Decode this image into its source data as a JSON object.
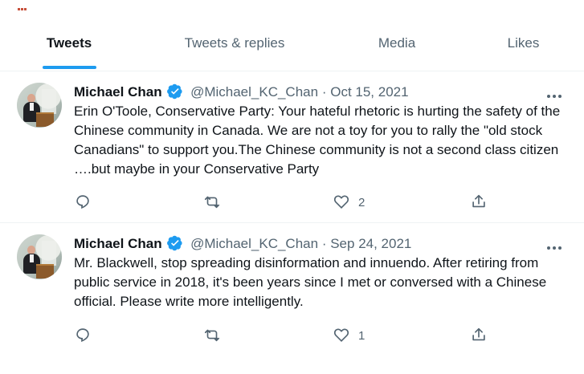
{
  "tabs": [
    {
      "label": "Tweets"
    },
    {
      "label": "Tweets & replies"
    },
    {
      "label": "Media"
    },
    {
      "label": "Likes"
    }
  ],
  "tweets": [
    {
      "author": "Michael Chan",
      "handle": "@Michael_KC_Chan",
      "separator": "·",
      "date": "Oct 15, 2021",
      "text": "Erin O'Toole, Conservative Party: Your hateful rhetoric is hurting the safety of the Chinese community in Canada. We are not a toy for you to rally the \"old stock Canadians\" to support you.The Chinese community is not a second class citizen ….but maybe in your Conservative Party",
      "likes": "2"
    },
    {
      "author": "Michael Chan",
      "handle": "@Michael_KC_Chan",
      "separator": "·",
      "date": "Sep 24, 2021",
      "text": "Mr. Blackwell, stop spreading disinformation and innuendo. After retiring from public service in 2018, it's been years since I met or conversed with a Chinese official.  Please write more intelligently.",
      "likes": "1"
    }
  ],
  "icons": {
    "verified": "verified-badge-icon",
    "more": "more-options-icon",
    "reply": "reply-icon",
    "retweet": "retweet-icon",
    "like": "like-icon",
    "share": "share-icon"
  },
  "colors": {
    "accent": "#1d9bf0",
    "secondary_text": "#536471",
    "primary_text": "#0f1419",
    "divider": "#eff3f4"
  }
}
